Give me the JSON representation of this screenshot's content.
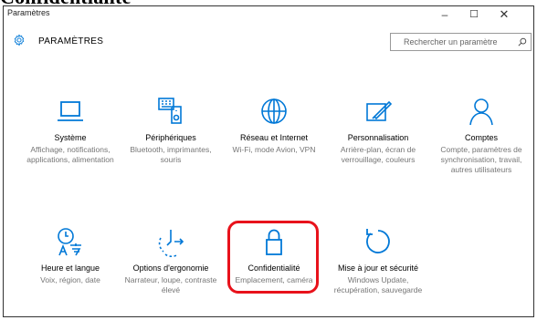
{
  "doc_title": "Confidentialité",
  "window": {
    "title": "Paramètres",
    "controls": {
      "minimize": "–",
      "maximize": "☐",
      "close": "✕"
    }
  },
  "header": {
    "title": "PARAMÈTRES",
    "search_placeholder": "Rechercher un paramètre"
  },
  "accent_color": "#0078d7",
  "highlight_color": "#e8121b",
  "tiles": [
    {
      "label": "Système",
      "desc": "Affichage, notifications, applications, alimentation",
      "icon": "laptop-icon"
    },
    {
      "label": "Périphériques",
      "desc": "Bluetooth, imprimantes, souris",
      "icon": "devices-icon"
    },
    {
      "label": "Réseau et Internet",
      "desc": "Wi-Fi, mode Avion, VPN",
      "icon": "globe-icon"
    },
    {
      "label": "Personnalisation",
      "desc": "Arrière-plan, écran de verrouillage, couleurs",
      "icon": "paint-icon"
    },
    {
      "label": "Comptes",
      "desc": "Compte, paramètres de synchronisation, travail, autres utilisateurs",
      "icon": "person-icon"
    },
    {
      "label": "Heure et langue",
      "desc": "Voix, région, date",
      "icon": "time-language-icon"
    },
    {
      "label": "Options d'ergonomie",
      "desc": "Narrateur, loupe, contraste élevé",
      "icon": "ease-of-access-icon"
    },
    {
      "label": "Confidentialité",
      "desc": "Emplacement, caméra",
      "icon": "lock-icon"
    },
    {
      "label": "Mise à jour et sécurité",
      "desc": "Windows Update, récupération, sauvegarde",
      "icon": "update-icon"
    }
  ]
}
